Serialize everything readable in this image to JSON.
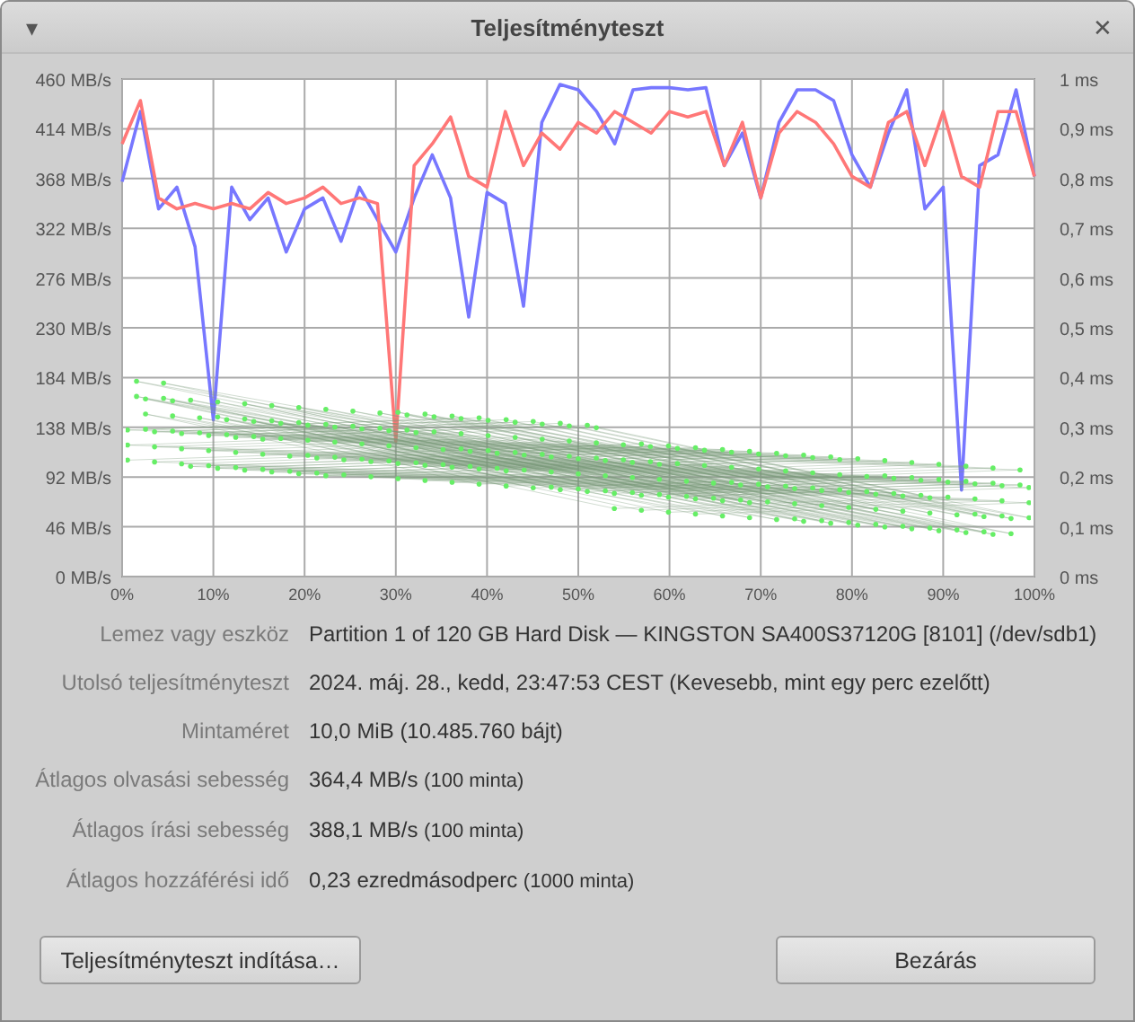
{
  "window": {
    "title": "Teljesítményteszt",
    "menu_glyph": "▾",
    "close_glyph": "✕"
  },
  "chart": {
    "chart_data": {
      "type": "line",
      "x": [
        0,
        2,
        4,
        6,
        8,
        10,
        12,
        14,
        16,
        18,
        20,
        22,
        24,
        26,
        28,
        30,
        32,
        34,
        36,
        38,
        40,
        42,
        44,
        46,
        48,
        50,
        52,
        54,
        56,
        58,
        60,
        62,
        64,
        66,
        68,
        70,
        72,
        74,
        76,
        78,
        80,
        82,
        84,
        86,
        88,
        90,
        92,
        94,
        96,
        98,
        100
      ],
      "series": [
        {
          "color": "#7777ff",
          "values": [
            365,
            430,
            340,
            360,
            305,
            145,
            360,
            330,
            350,
            300,
            340,
            350,
            310,
            360,
            330,
            300,
            350,
            390,
            350,
            240,
            355,
            345,
            250,
            420,
            455,
            450,
            430,
            400,
            450,
            452,
            452,
            450,
            452,
            380,
            410,
            350,
            420,
            450,
            450,
            440,
            390,
            360,
            410,
            450,
            340,
            360,
            80,
            380,
            390,
            450,
            370
          ]
        },
        {
          "color": "#ff7777",
          "values": [
            400,
            440,
            350,
            340,
            345,
            340,
            345,
            340,
            355,
            345,
            350,
            360,
            345,
            350,
            345,
            125,
            380,
            400,
            425,
            370,
            360,
            430,
            380,
            410,
            395,
            420,
            410,
            430,
            420,
            410,
            430,
            425,
            430,
            380,
            420,
            350,
            410,
            430,
            420,
            400,
            370,
            360,
            420,
            430,
            380,
            430,
            370,
            360,
            430,
            430,
            370
          ]
        }
      ],
      "grid": true,
      "xlim": [
        0,
        100
      ],
      "ylim": [
        0,
        460
      ],
      "xticks": [
        {
          "value": 0,
          "label": "0%"
        },
        {
          "value": 10,
          "label": "10%"
        },
        {
          "value": 20,
          "label": "20%"
        },
        {
          "value": 30,
          "label": "30%"
        },
        {
          "value": 40,
          "label": "40%"
        },
        {
          "value": 50,
          "label": "50%"
        },
        {
          "value": 60,
          "label": "60%"
        },
        {
          "value": 70,
          "label": "70%"
        },
        {
          "value": 80,
          "label": "80%"
        },
        {
          "value": 90,
          "label": "90%"
        },
        {
          "value": 100,
          "label": "100%"
        }
      ],
      "yticks": [
        {
          "value": 0,
          "label": "0 MB/s"
        },
        {
          "value": 46,
          "label": "46 MB/s"
        },
        {
          "value": 92,
          "label": "92 MB/s"
        },
        {
          "value": 138,
          "label": "138 MB/s"
        },
        {
          "value": 184,
          "label": "184 MB/s"
        },
        {
          "value": 230,
          "label": "230 MB/s"
        },
        {
          "value": 276,
          "label": "276 MB/s"
        },
        {
          "value": 322,
          "label": "322 MB/s"
        },
        {
          "value": 368,
          "label": "368 MB/s"
        },
        {
          "value": 414,
          "label": "414 MB/s"
        },
        {
          "value": 460,
          "label": "460 MB/s"
        }
      ]
    },
    "right_axis_labels": [
      "1 ms",
      "0,9 ms",
      "0,8 ms",
      "0,7 ms",
      "0,6 ms",
      "0,5 ms",
      "0,4 ms",
      "0,3 ms",
      "0,2 ms",
      "0,1 ms",
      "0 ms"
    ]
  },
  "info": [
    {
      "label": "Lemez vagy eszköz",
      "value": "Partition 1 of 120 GB Hard Disk — KINGSTON SA400S37120G [8101] (/dev/sdb1)"
    },
    {
      "label": "Utolsó teljesítményteszt",
      "value": "2024. máj. 28., kedd, 23:47:53 CEST (Kevesebb, mint egy perc ezelőtt)"
    },
    {
      "label": "Mintaméret",
      "value": "10,0 MiB (10.485.760 bájt)"
    },
    {
      "label": "Átlagos olvasási sebesség",
      "value": "364,4 MB/s",
      "note": "(100 minta)"
    },
    {
      "label": "Átlagos írási sebesség",
      "value": "388,1 MB/s",
      "note": "(100 minta)"
    },
    {
      "label": "Átlagos hozzáférési idő",
      "value": "0,23 ezredmásodperc",
      "note": "(1000 minta)"
    }
  ],
  "buttons": [
    "Teljesítményteszt indítása…",
    "Bezárás"
  ]
}
